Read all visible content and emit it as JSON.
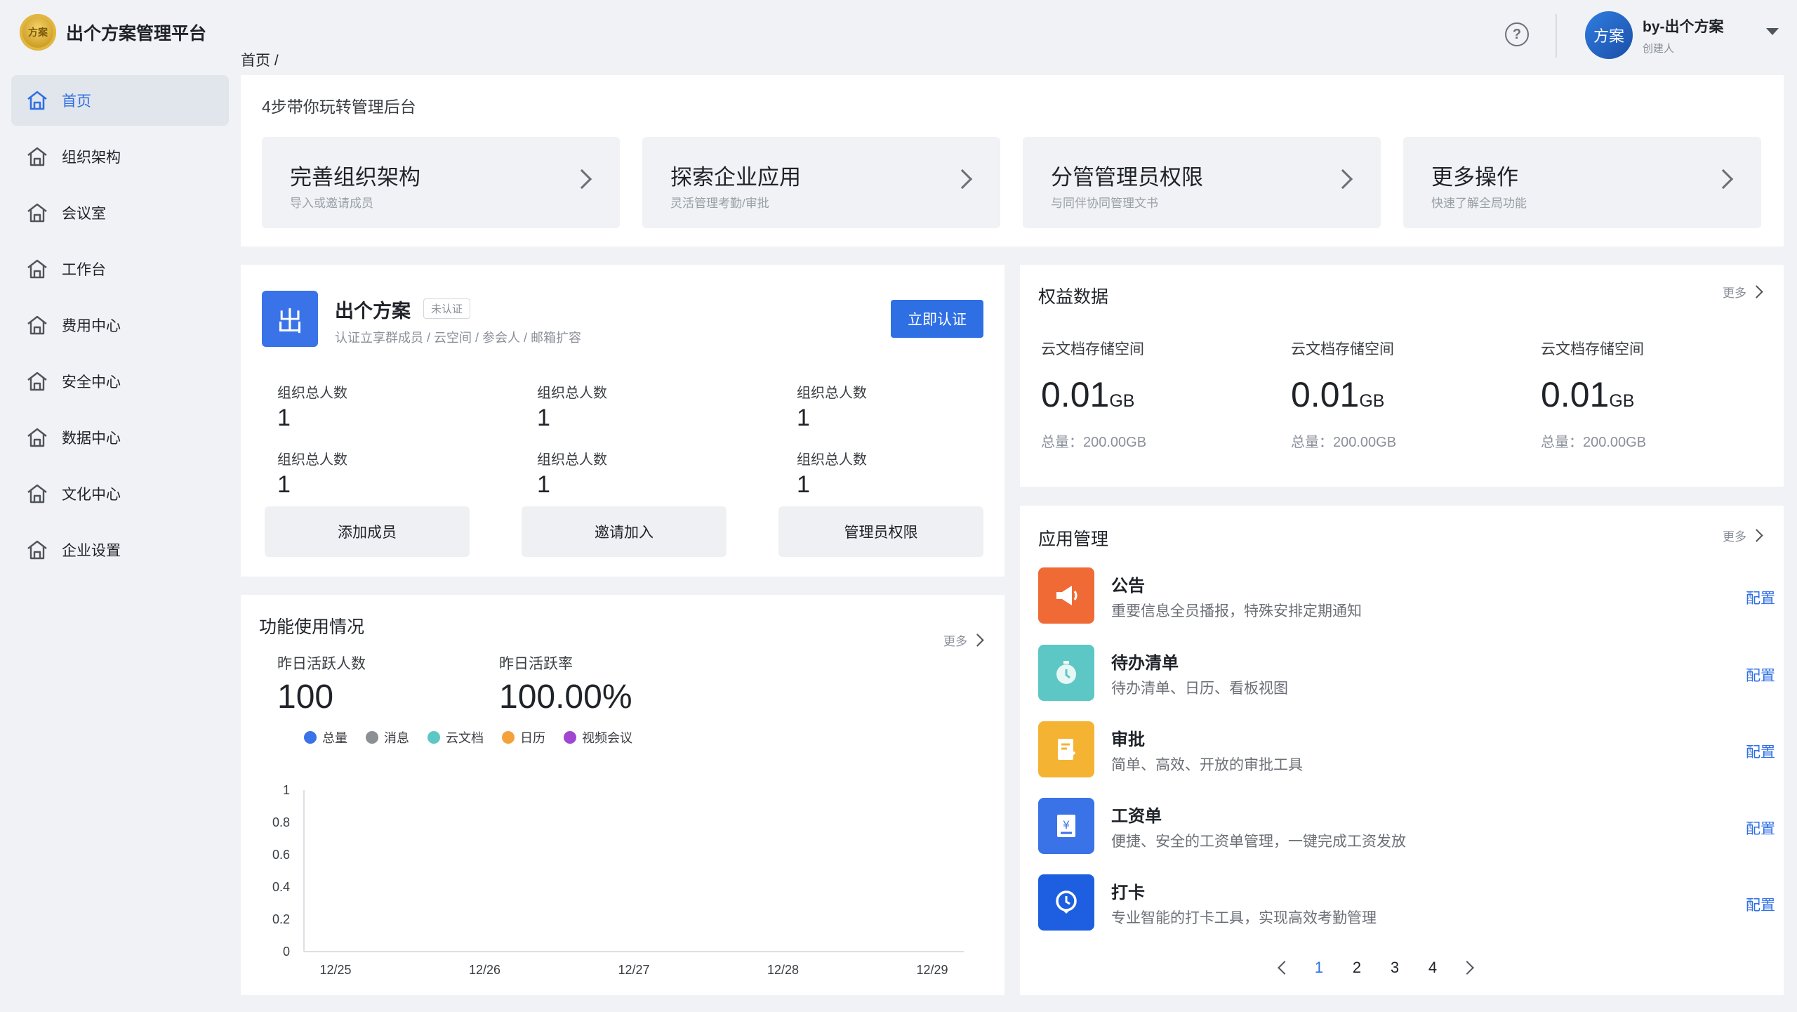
{
  "app": {
    "title": "出个方案管理平台",
    "logo_text": "方案"
  },
  "header": {
    "help_symbol": "?",
    "user": {
      "avatar_text": "方案",
      "name": "by-出个方案",
      "role": "创建人"
    }
  },
  "breadcrumb": "首页 /",
  "sidebar": {
    "items": [
      {
        "label": "首页",
        "active": true
      },
      {
        "label": "组织架构"
      },
      {
        "label": "会议室"
      },
      {
        "label": "工作台"
      },
      {
        "label": "费用中心"
      },
      {
        "label": "安全中心"
      },
      {
        "label": "数据中心"
      },
      {
        "label": "文化中心"
      },
      {
        "label": "企业设置"
      }
    ]
  },
  "guide": {
    "title": "4步带你玩转管理后台",
    "steps": [
      {
        "title": "完善组织架构",
        "subtitle": "导入或邀请成员"
      },
      {
        "title": "探索企业应用",
        "subtitle": "灵活管理考勤/审批"
      },
      {
        "title": "分管管理员权限",
        "subtitle": "与同伴协同管理文书"
      },
      {
        "title": "更多操作",
        "subtitle": "快速了解全局功能"
      }
    ]
  },
  "org": {
    "logo_char": "出",
    "name": "出个方案",
    "badge": "未认证",
    "subtitle": "认证立享群成员 / 云空间 / 参会人 / 邮箱扩容",
    "certify_label": "立即认证",
    "stats": [
      {
        "label": "组织总人数",
        "value": "1"
      },
      {
        "label": "组织总人数",
        "value": "1"
      },
      {
        "label": "组织总人数",
        "value": "1"
      },
      {
        "label": "组织总人数",
        "value": "1"
      },
      {
        "label": "组织总人数",
        "value": "1"
      },
      {
        "label": "组织总人数",
        "value": "1"
      }
    ],
    "buttons": [
      "添加成员",
      "邀请加入",
      "管理员权限"
    ]
  },
  "usage": {
    "title": "功能使用情况",
    "more": "更多",
    "kpis": [
      {
        "label": "昨日活跃人数",
        "value": "100"
      },
      {
        "label": "昨日活跃率",
        "value": "100.00%"
      }
    ]
  },
  "chart_data": {
    "type": "line",
    "x": [
      "12/25",
      "12/26",
      "12/27",
      "12/28",
      "12/29"
    ],
    "ylim": [
      0,
      1
    ],
    "yticks": [
      "0",
      "0.2",
      "0.4",
      "0.6",
      "0.8",
      "1"
    ],
    "series": [
      {
        "name": "总量",
        "color": "#3a72e8",
        "values": []
      },
      {
        "name": "消息",
        "color": "#8c8f94",
        "values": []
      },
      {
        "name": "云文档",
        "color": "#5cc7c4",
        "values": []
      },
      {
        "name": "日历",
        "color": "#f5a13a",
        "values": []
      },
      {
        "name": "视频会议",
        "color": "#a046d1",
        "values": []
      }
    ]
  },
  "rights": {
    "title": "权益数据",
    "more": "更多",
    "items": [
      {
        "label": "云文档存储空间",
        "value": "0.01",
        "unit": "GB",
        "total": "总量：200.00GB"
      },
      {
        "label": "云文档存储空间",
        "value": "0.01",
        "unit": "GB",
        "total": "总量：200.00GB"
      },
      {
        "label": "云文档存储空间",
        "value": "0.01",
        "unit": "GB",
        "total": "总量：200.00GB"
      }
    ]
  },
  "apps": {
    "title": "应用管理",
    "more": "更多",
    "items": [
      {
        "name": "公告",
        "desc": "重要信息全员播报，特殊安排定期通知",
        "action": "配置",
        "icon": "megaphone-icon",
        "color": "#f06a35"
      },
      {
        "name": "待办清单",
        "desc": "待办清单、日历、看板视图",
        "action": "配置",
        "icon": "timer-icon",
        "color": "#5cc7c4"
      },
      {
        "name": "审批",
        "desc": "简单、高效、开放的审批工具",
        "action": "配置",
        "icon": "approval-icon",
        "color": "#f5b334"
      },
      {
        "name": "工资单",
        "desc": "便捷、安全的工资单管理，一键完成工资发放",
        "action": "配置",
        "icon": "payslip-icon",
        "color": "#3a72e8"
      },
      {
        "name": "打卡",
        "desc": "专业智能的打卡工具，实现高效考勤管理",
        "action": "配置",
        "icon": "clock-icon",
        "color": "#1d5fe0"
      }
    ],
    "pagination": {
      "pages": [
        "1",
        "2",
        "3",
        "4"
      ],
      "current": "1"
    }
  }
}
